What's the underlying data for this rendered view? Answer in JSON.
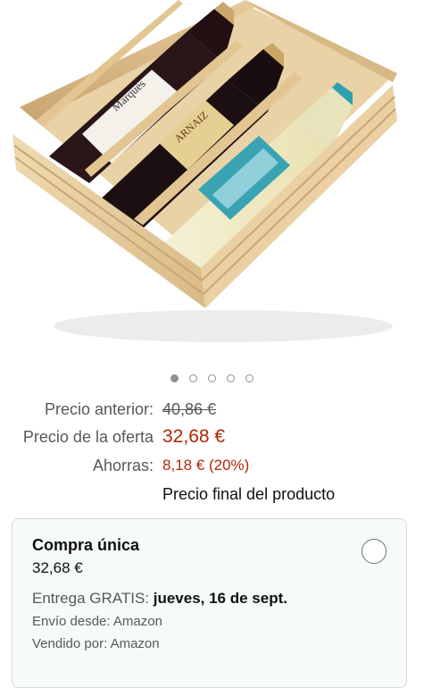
{
  "carousel": {
    "image_alt": "",
    "dot_count": 5,
    "active_index": 0
  },
  "pricing": {
    "previous_label": "Precio anterior:",
    "previous_value": "40,86 €",
    "deal_label": "Precio de la oferta",
    "deal_value": "32,68 €",
    "savings_label": "Ahorras:",
    "savings_value": "8,18 € (20%)",
    "final_note": "Precio final del producto"
  },
  "purchase_option": {
    "title": "Compra única",
    "price": "32,68 €",
    "delivery_prefix": "Entrega GRATIS:",
    "delivery_date": "jueves, 16 de sept.",
    "ships_from": "Envío desde: Amazon",
    "sold_by": "Vendido por: Amazon"
  },
  "colors": {
    "price_red": "#b12704",
    "muted_text": "#565959",
    "card_bg": "#f7fafa"
  }
}
